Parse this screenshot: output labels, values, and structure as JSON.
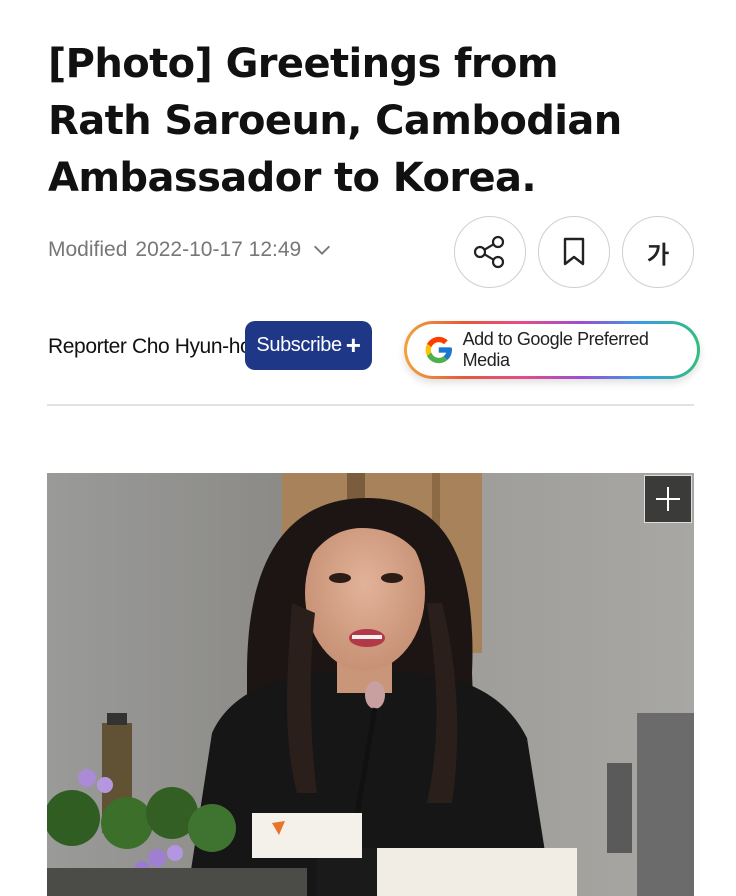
{
  "article": {
    "headline": "[Photo] Greetings from Rath Saroeun, Cambodian Ambassador to Korea.",
    "modified_label": "Modified",
    "modified_datetime": "2022-10-17 12:49",
    "reporter": "Reporter Cho Hyun-ho"
  },
  "actions": {
    "share_icon": "share-icon",
    "bookmark_icon": "bookmark-icon",
    "font_size_label": "가"
  },
  "subscribe": {
    "label": "Subscribe",
    "plus": "+"
  },
  "google_preferred": {
    "label": "Add to Google Preferred Media"
  },
  "photo": {
    "expand_icon": "plus-icon"
  },
  "colors": {
    "subscribe_bg": "#1e3787",
    "text": "#111111",
    "meta": "#777777"
  }
}
